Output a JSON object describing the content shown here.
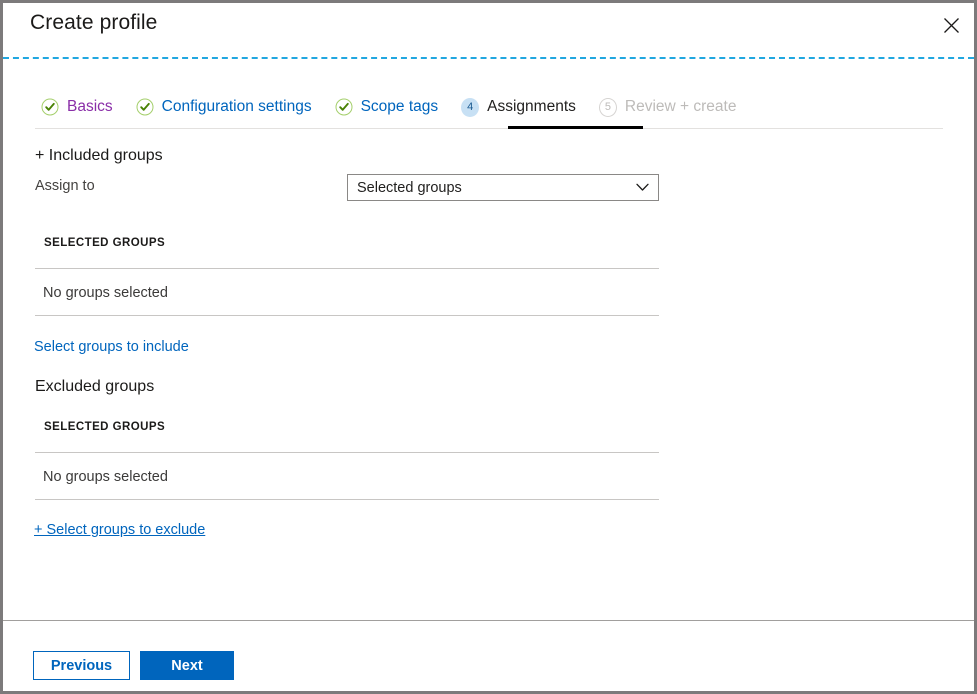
{
  "window": {
    "title": "Create profile",
    "close_icon": "close-icon"
  },
  "wizard": {
    "tabs": [
      {
        "index": "1",
        "label": "Basics",
        "state": "completed",
        "icon": "check-circle-icon"
      },
      {
        "index": "2",
        "label": "Configuration settings",
        "state": "completed",
        "icon": "check-circle-icon"
      },
      {
        "index": "3",
        "label": "Scope tags",
        "state": "completed",
        "icon": "check-circle-icon"
      },
      {
        "index": "4",
        "label": "Assignments",
        "state": "current",
        "icon": "number-badge"
      },
      {
        "index": "5",
        "label": "Review + create",
        "state": "disabled",
        "icon": "number-badge"
      }
    ]
  },
  "included": {
    "heading": "+ Included groups",
    "assign_to_label": "Assign to",
    "assign_to_value": "Selected groups",
    "assign_to_options": [
      "Selected groups"
    ],
    "caret_icon": "chevron-down-icon",
    "grid_header": "SELECTED GROUPS",
    "empty_text": "No groups selected",
    "select_link": "Select groups to include"
  },
  "excluded": {
    "heading": "Excluded groups",
    "grid_header": "SELECTED GROUPS",
    "empty_text": "No groups selected",
    "select_link": "+ Select groups to exclude"
  },
  "footer": {
    "previous_label": "Previous",
    "next_label": "Next"
  },
  "colors": {
    "accent": "#0065bd",
    "visited_link": "#8a2ea8",
    "dashed_rule": "#21a7e0",
    "check_green": "#498205",
    "current_badge_bg": "#c7e0f4",
    "disabled_text": "#bdbbb9"
  }
}
